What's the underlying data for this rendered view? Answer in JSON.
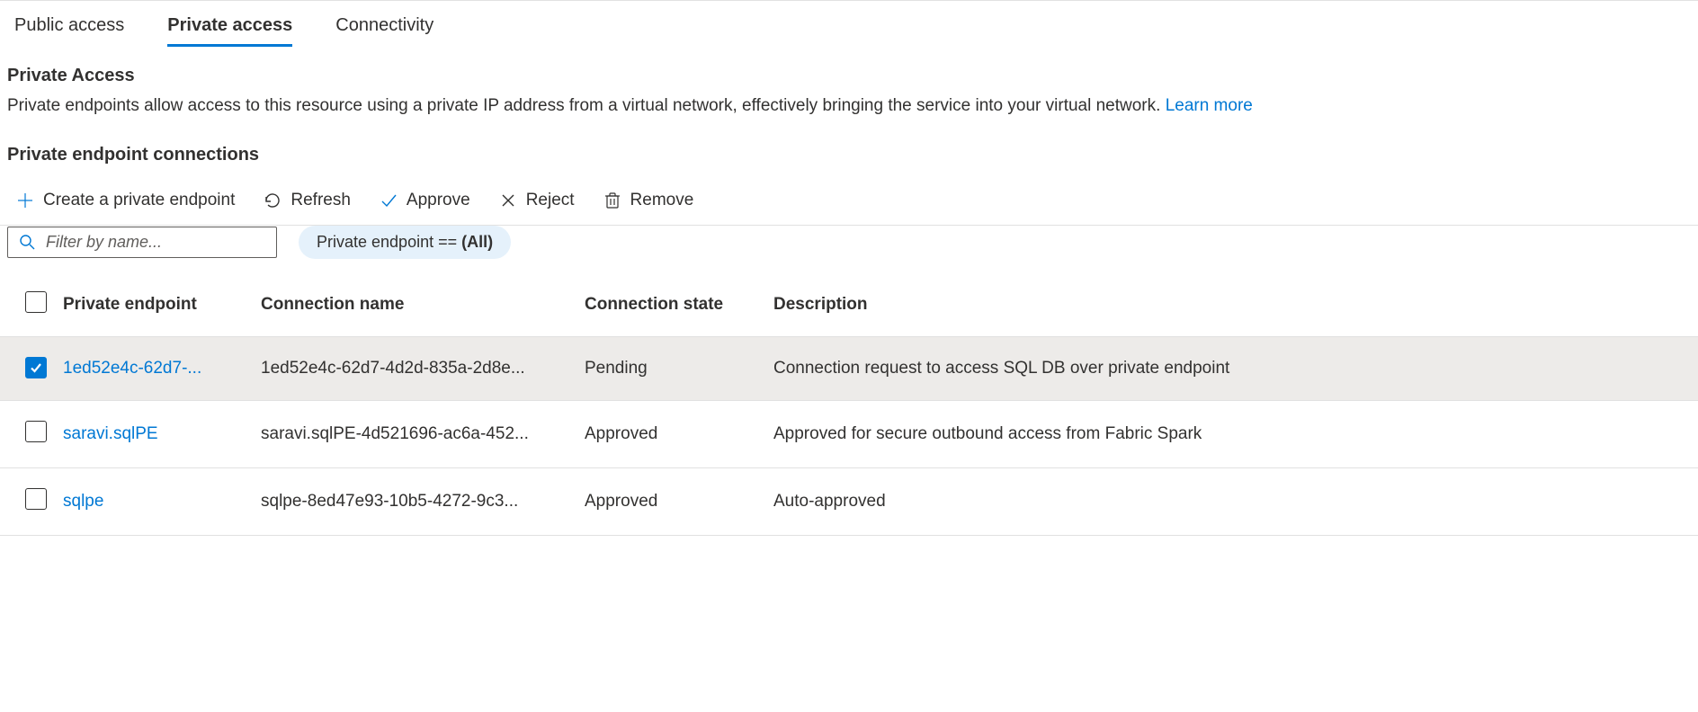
{
  "tabs": [
    {
      "label": "Public access",
      "active": false
    },
    {
      "label": "Private access",
      "active": true
    },
    {
      "label": "Connectivity",
      "active": false
    }
  ],
  "section": {
    "title": "Private Access",
    "description": "Private endpoints allow access to this resource using a private IP address from a virtual network, effectively bringing the service into your virtual network. ",
    "learn_more": "Learn more"
  },
  "subsection": {
    "title": "Private endpoint connections"
  },
  "toolbar": {
    "create": "Create a private endpoint",
    "refresh": "Refresh",
    "approve": "Approve",
    "reject": "Reject",
    "remove": "Remove"
  },
  "filter": {
    "search_placeholder": "Filter by name...",
    "pill_prefix": "Private endpoint == ",
    "pill_value": "(All)"
  },
  "table": {
    "headers": {
      "endpoint": "Private endpoint",
      "connection_name": "Connection name",
      "connection_state": "Connection state",
      "description": "Description"
    },
    "rows": [
      {
        "checked": true,
        "endpoint": "1ed52e4c-62d7-...",
        "connection_name": "1ed52e4c-62d7-4d2d-835a-2d8e...",
        "connection_state": "Pending",
        "description": "Connection request to access SQL DB over private endpoint"
      },
      {
        "checked": false,
        "endpoint": "saravi.sqlPE",
        "connection_name": "saravi.sqlPE-4d521696-ac6a-452...",
        "connection_state": "Approved",
        "description": "Approved for secure outbound access from Fabric Spark"
      },
      {
        "checked": false,
        "endpoint": "sqlpe",
        "connection_name": "sqlpe-8ed47e93-10b5-4272-9c3...",
        "connection_state": "Approved",
        "description": "Auto-approved"
      }
    ]
  }
}
